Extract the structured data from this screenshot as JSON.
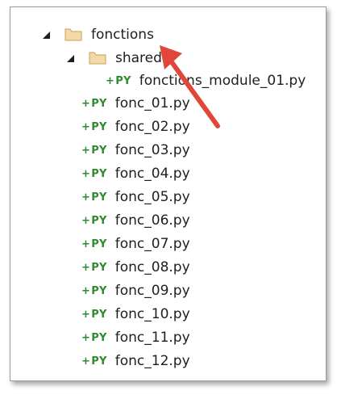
{
  "tree": {
    "root_folder": {
      "label": "fonctions",
      "icon": "folder-icon",
      "expanded": true
    },
    "sub_folder": {
      "label": "shared",
      "icon": "folder-icon",
      "expanded": true
    },
    "sub_files": [
      {
        "label": "fonctions_module_01.py",
        "icon_text": "PY",
        "icon_plus": "+"
      }
    ],
    "files": [
      {
        "label": "fonc_01.py",
        "icon_text": "PY",
        "icon_plus": "+"
      },
      {
        "label": "fonc_02.py",
        "icon_text": "PY",
        "icon_plus": "+"
      },
      {
        "label": "fonc_03.py",
        "icon_text": "PY",
        "icon_plus": "+"
      },
      {
        "label": "fonc_04.py",
        "icon_text": "PY",
        "icon_plus": "+"
      },
      {
        "label": "fonc_05.py",
        "icon_text": "PY",
        "icon_plus": "+"
      },
      {
        "label": "fonc_06.py",
        "icon_text": "PY",
        "icon_plus": "+"
      },
      {
        "label": "fonc_07.py",
        "icon_text": "PY",
        "icon_plus": "+"
      },
      {
        "label": "fonc_08.py",
        "icon_text": "PY",
        "icon_plus": "+"
      },
      {
        "label": "fonc_09.py",
        "icon_text": "PY",
        "icon_plus": "+"
      },
      {
        "label": "fonc_10.py",
        "icon_text": "PY",
        "icon_plus": "+"
      },
      {
        "label": "fonc_11.py",
        "icon_text": "PY",
        "icon_plus": "+"
      },
      {
        "label": "fonc_12.py",
        "icon_text": "PY",
        "icon_plus": "+"
      }
    ]
  },
  "colors": {
    "py_icon": "#2f8a2f",
    "folder_fill": "#f3d9a8",
    "folder_stroke": "#c9a15a",
    "annotation_arrow": "#e0463a"
  }
}
